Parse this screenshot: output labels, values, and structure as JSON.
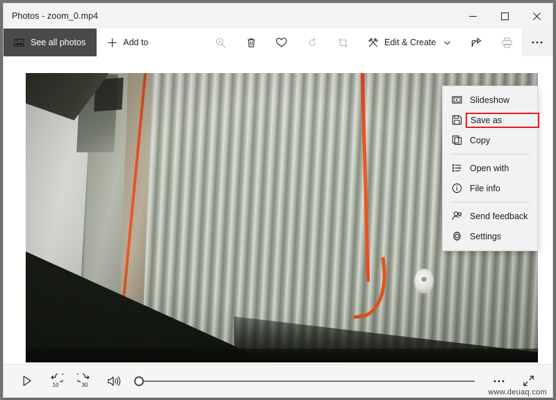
{
  "window": {
    "title": "Photos - zoom_0.mp4",
    "controls": {
      "minimize": "minimize",
      "maximize": "maximize",
      "close": "close"
    }
  },
  "toolbar": {
    "see_all_photos": "See all photos",
    "add_to": "Add to",
    "zoom_in": "Zoom in",
    "delete": "Delete",
    "favorite": "Add to favorites",
    "rotate": "Rotate",
    "crop": "Crop",
    "edit_create": "Edit & Create",
    "share": "Share",
    "print": "Print",
    "see_more": "See more"
  },
  "context_menu": {
    "highlight_color": "#ec1c24",
    "items": [
      {
        "label": "Slideshow",
        "icon": "slideshow-icon",
        "highlighted": false
      },
      {
        "label": "Save as",
        "icon": "save-icon",
        "highlighted": true
      },
      {
        "label": "Copy",
        "icon": "copy-icon",
        "highlighted": false
      },
      {
        "label": "Open with",
        "icon": "open-with-icon",
        "highlighted": false
      },
      {
        "label": "File info",
        "icon": "info-icon",
        "highlighted": false
      },
      {
        "label": "Send feedback",
        "icon": "feedback-icon",
        "highlighted": false
      },
      {
        "label": "Settings",
        "icon": "gear-icon",
        "highlighted": false
      }
    ]
  },
  "player": {
    "play": "Play",
    "rewind_label": "10",
    "forward_label": "30",
    "volume": "Volume",
    "seek_position_percent": 0,
    "more_options": "More options",
    "fullscreen": "Full screen"
  },
  "watermark": "www.deuaq.com",
  "photo": {
    "description": "Corrugated metal wall with orange cable running to a white outlet"
  }
}
